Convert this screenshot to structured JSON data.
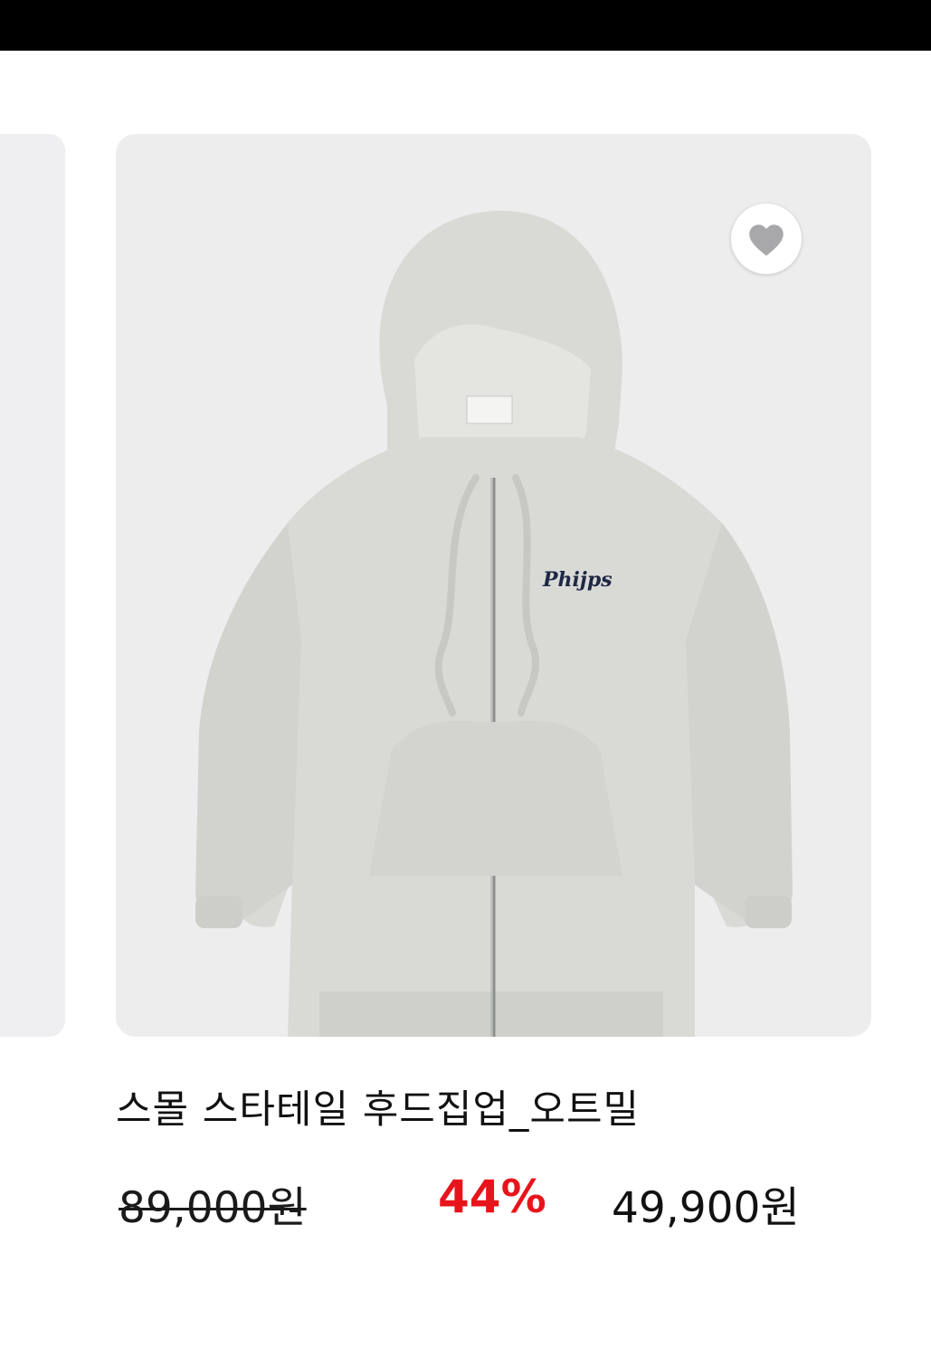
{
  "product": {
    "name": "스몰 스타테일 후드집업_오트밀",
    "original_price": "89,000원",
    "discount_rate": "44%",
    "sale_price": "49,900원",
    "image_logo_text": "Phijps",
    "wishlist_icon": "heart-icon"
  },
  "colors": {
    "top_bar": "#000000",
    "card_background": "#ededee",
    "discount": "#e8141b",
    "hoodie": "#d9dad6"
  }
}
